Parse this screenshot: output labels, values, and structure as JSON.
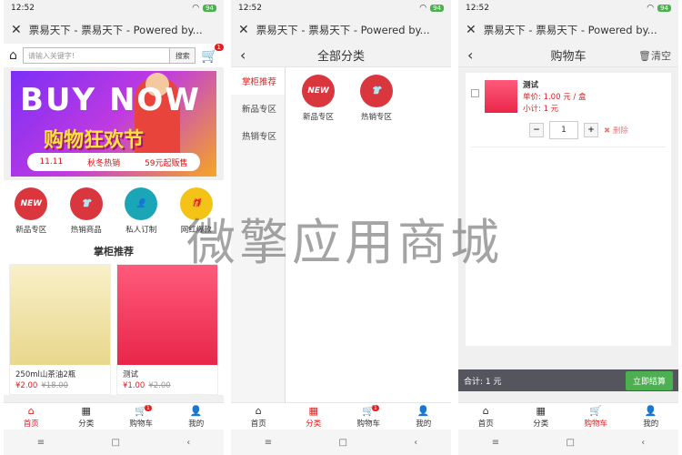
{
  "status": {
    "time": "12:52",
    "battery": "94"
  },
  "window_title": "票易天下 - 票易天下 - Powered by...",
  "home": {
    "search_placeholder": "请输入关键字!",
    "search_button": "搜索",
    "cart_badge": "1",
    "banner_big": "BUY NOW",
    "banner_cn": "购物狂欢节",
    "banner_sub1": "11.11",
    "banner_sub2": "秋冬热销",
    "banner_sub3": "59元起贩售",
    "categories": [
      "新品专区",
      "热销商品",
      "私人订制",
      "网红爆款"
    ],
    "section_title": "掌柜推荐",
    "products": [
      {
        "title": "250ml山茶油2瓶",
        "price": "¥2.00",
        "old": "¥18.00"
      },
      {
        "title": "测试",
        "price": "¥1.00",
        "old": "¥2.00"
      }
    ]
  },
  "category_page": {
    "title": "全部分类",
    "left": [
      "掌柜推荐",
      "新品专区",
      "热销专区"
    ],
    "right": [
      "新品专区",
      "热销专区"
    ]
  },
  "cart_page": {
    "title": "购物车",
    "clear": "清空",
    "item_name": "测试",
    "unit_price": "单价: 1.00 元 / 盒",
    "subtotal": "小计: 1 元",
    "qty": "1",
    "delete": "删除",
    "total": "合计: 1 元",
    "checkout": "立即结算"
  },
  "tabs": [
    "首页",
    "分类",
    "购物车",
    "我的"
  ],
  "tab_badge": "1",
  "watermark": "微擎应用商城"
}
